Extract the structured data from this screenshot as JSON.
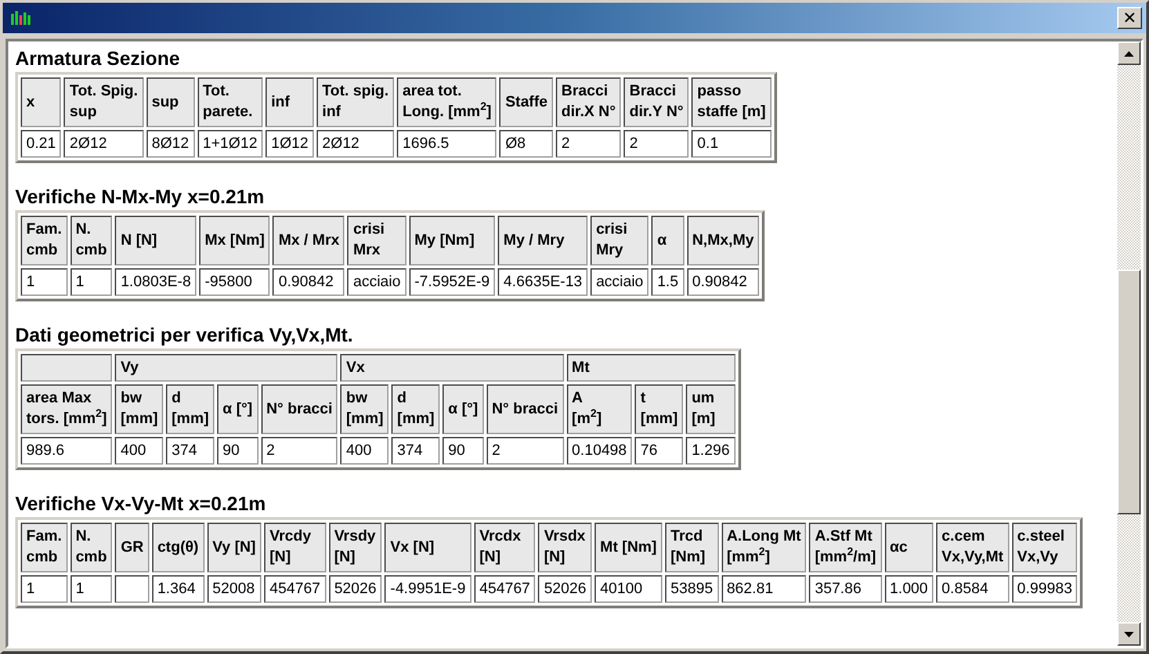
{
  "window": {
    "close": "✕"
  },
  "sections": [
    {
      "title": "Armatura Sezione",
      "groups": [
        {
          "columns": [
            {
              "text": "x"
            },
            {
              "text": "Tot. Spig.\nsup"
            },
            {
              "text": "sup"
            },
            {
              "text": "Tot.\nparete."
            },
            {
              "text": "inf"
            },
            {
              "text": "Tot. spig.\ninf"
            },
            {
              "text": "area tot.\nLong. [mm$^{2}$]"
            },
            {
              "text": "Staffe"
            },
            {
              "text": "Bracci\ndir.X N°"
            },
            {
              "text": "Bracci\ndir.Y N°"
            },
            {
              "text": "passo\nstaffe [m]"
            }
          ]
        }
      ],
      "rows": [
        [
          "0.21",
          "2Ø12",
          "8Ø12",
          "1+1Ø12",
          "1Ø12",
          "2Ø12",
          "1696.5",
          "Ø8",
          "2",
          "2",
          "0.1"
        ]
      ]
    },
    {
      "title": "Verifiche N-Mx-My x=0.21m",
      "groups": [
        {
          "columns": [
            {
              "text": "Fam.\ncmb"
            },
            {
              "text": "N.\ncmb"
            },
            {
              "text": "N [N]"
            },
            {
              "text": "Mx [Nm]"
            },
            {
              "text": "Mx / Mrx"
            },
            {
              "text": "crisi\nMrx"
            },
            {
              "text": "My [Nm]"
            },
            {
              "text": "My / Mry"
            },
            {
              "text": "crisi\nMry"
            },
            {
              "text": "α"
            },
            {
              "text": "N,Mx,My"
            }
          ]
        }
      ],
      "rows": [
        [
          "1",
          "1",
          "1.0803E-8",
          "-95800",
          "0.90842",
          "acciaio",
          "-7.5952E-9",
          "4.6635E-13",
          "acciaio",
          "1.5",
          "0.90842"
        ]
      ]
    },
    {
      "title": "Dati geometrici per verifica Vy,Vx,Mt.",
      "groups": [
        {
          "columns": [
            {
              "text": "area Max\ntors. [mm$^{2}$]"
            }
          ]
        },
        {
          "text": "Vy",
          "columns": [
            {
              "text": "bw\n[mm]"
            },
            {
              "text": "d\n[mm]"
            },
            {
              "text": "α [°]"
            },
            {
              "text": "N° bracci"
            }
          ]
        },
        {
          "text": "Vx",
          "columns": [
            {
              "text": "bw\n[mm]"
            },
            {
              "text": "d\n[mm]"
            },
            {
              "text": "α [°]"
            },
            {
              "text": "N° bracci"
            }
          ]
        },
        {
          "text": "Mt",
          "columns": [
            {
              "text": "A\n[m$^{2}$]"
            },
            {
              "text": "t\n[mm]"
            },
            {
              "text": "um\n[m]"
            }
          ]
        }
      ],
      "rows": [
        [
          "989.6",
          "400",
          "374",
          "90",
          "2",
          "400",
          "374",
          "90",
          "2",
          "0.10498",
          "76",
          "1.296"
        ]
      ]
    },
    {
      "title": "Verifiche Vx-Vy-Mt x=0.21m",
      "groups": [
        {
          "columns": [
            {
              "text": "Fam.\ncmb"
            },
            {
              "text": "N.\ncmb"
            },
            {
              "text": "GR"
            },
            {
              "text": "ctg(θ)"
            },
            {
              "text": "Vy [N]"
            },
            {
              "text": "Vrcdy\n[N]"
            },
            {
              "text": "Vrsdy\n[N]"
            },
            {
              "text": "Vx [N]"
            },
            {
              "text": "Vrcdx\n[N]"
            },
            {
              "text": "Vrsdx\n[N]"
            },
            {
              "text": "Mt [Nm]"
            },
            {
              "text": "Trcd\n[Nm]"
            },
            {
              "text": "A.Long Mt\n[mm$^{2}$]"
            },
            {
              "text": "A.Stf Mt\n[mm$^{2}$/m]"
            },
            {
              "text": "αc"
            },
            {
              "text": "c.cem\nVx,Vy,Mt"
            },
            {
              "text": "c.steel\nVx,Vy"
            }
          ]
        }
      ],
      "rows": [
        [
          "1",
          "1",
          null,
          "1.364",
          "52008",
          "454767",
          "52026",
          "-4.9951E-9",
          "454767",
          "52026",
          "40100",
          "53895",
          "862.81",
          "357.86",
          "1.000",
          "0.8584",
          "0.99983"
        ]
      ]
    }
  ]
}
